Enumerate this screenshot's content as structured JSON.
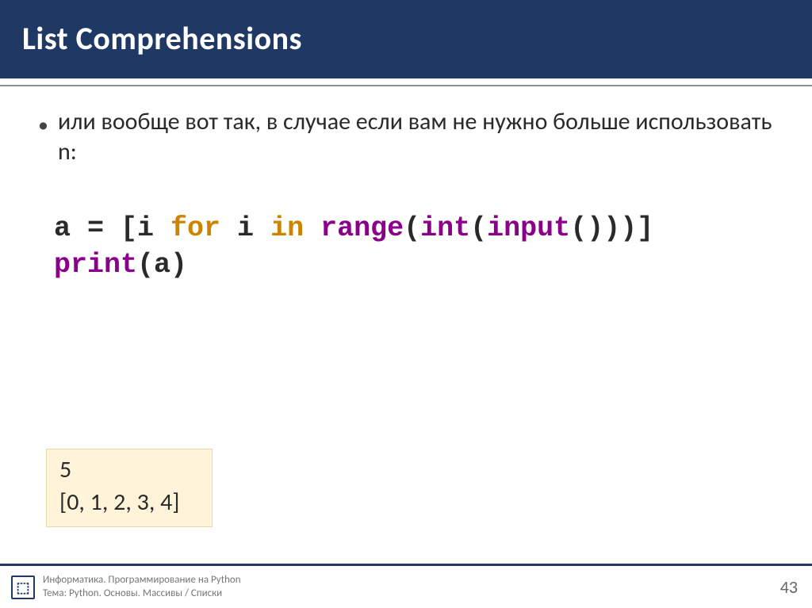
{
  "header": {
    "title": "List Comprehensions"
  },
  "bullet": {
    "text": "или вообще вот так, в случае если вам не нужно больше использовать n:"
  },
  "code": {
    "line1_a": "a = [i ",
    "line1_for": "for",
    "line1_b": " i ",
    "line1_in": "in",
    "line1_c": " ",
    "line1_range": "range",
    "line1_d": "(",
    "line1_int": "int",
    "line1_e": "(",
    "line1_input": "input",
    "line1_f": "()))]",
    "line2_print": "print",
    "line2_rest": "(a)"
  },
  "output": {
    "line1": "5",
    "line2": "[0, 1, 2, 3, 4]"
  },
  "footer": {
    "course": "Информатика. Программирование на Python",
    "topic": "Тема: Python. Основы. Массивы / Списки",
    "page": "43"
  }
}
